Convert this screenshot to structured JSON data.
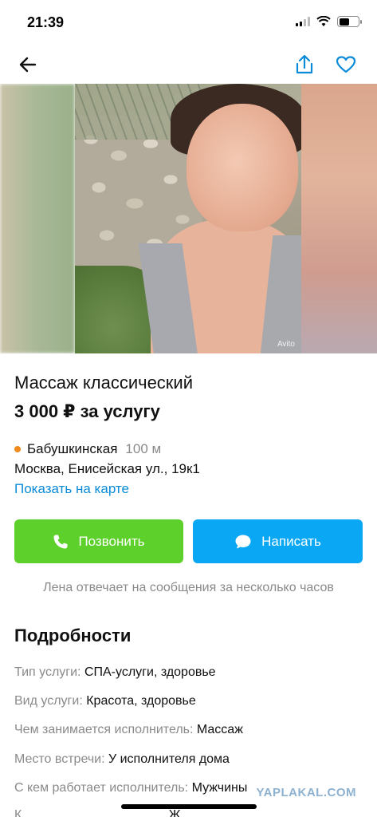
{
  "status_bar": {
    "time": "21:39",
    "battery_level": 0.55
  },
  "nav": {
    "back_icon": "arrow-left-icon",
    "share_icon": "share-icon",
    "favorite_icon": "heart-icon",
    "accent_color": "#0a8bd8"
  },
  "gallery": {
    "watermark": "Avito"
  },
  "listing": {
    "title": "Массаж классический",
    "price": "3 000 ₽ за услугу",
    "metro_name": "Бабушкинская",
    "metro_distance": "100 м",
    "metro_color": "#ef8a1e",
    "address": "Москва, Енисейская ул., 19к1",
    "map_link": "Показать на карте"
  },
  "actions": {
    "call_label": "Позвонить",
    "call_color": "#5ed02b",
    "write_label": "Написать",
    "write_color": "#0aa8f4",
    "reply_note": "Лена отвечает на сообщения за несколько часов"
  },
  "details": {
    "heading": "Подробности",
    "rows": [
      {
        "key": "Тип услуги:",
        "value": "СПА-услуги, здоровье"
      },
      {
        "key": "Вид услуги:",
        "value": "Красота, здоровье"
      },
      {
        "key": "Чем занимается исполнитель:",
        "value": "Массаж"
      },
      {
        "key": "Место встречи:",
        "value": "У исполнителя дома"
      },
      {
        "key": "С кем работает исполнитель:",
        "value": "Мужчины"
      },
      {
        "key": "К",
        "value": "Ж"
      }
    ]
  },
  "overlay": {
    "site_watermark": "YAPLAKAL.COM"
  }
}
